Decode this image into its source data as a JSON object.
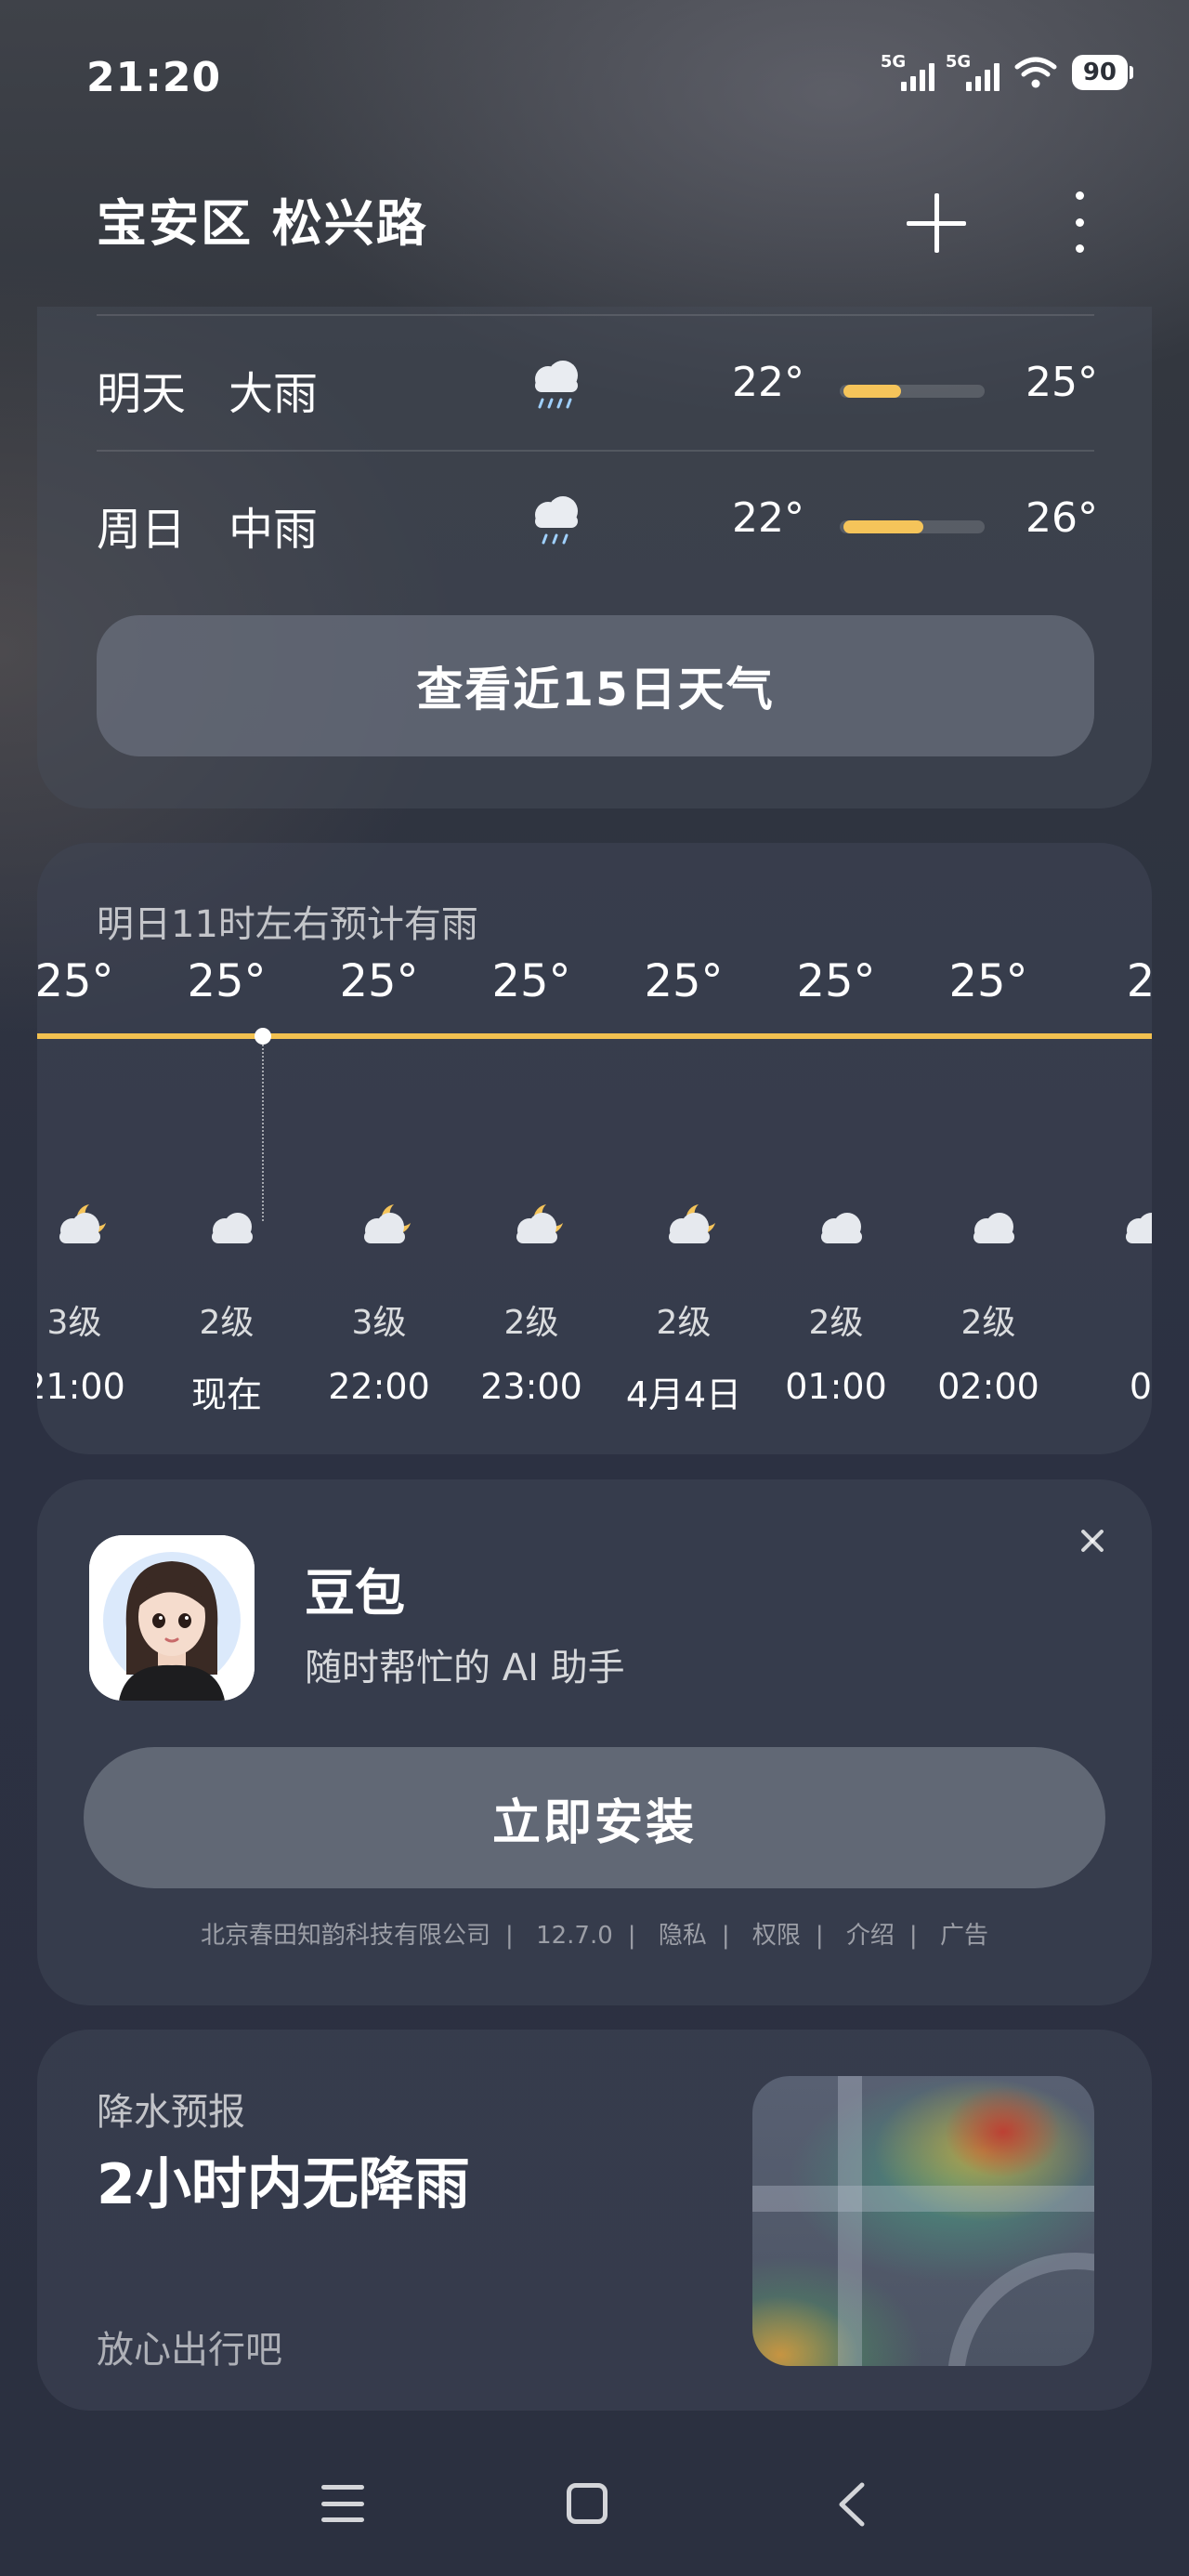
{
  "status_bar": {
    "time": "21:20",
    "sim1": "5G",
    "sim2": "5G",
    "battery": "90"
  },
  "header": {
    "location": "宝安区 松兴路",
    "add_icon": "plus-icon",
    "more_icon": "more-vertical-icon"
  },
  "daily": {
    "rows": [
      {
        "day": "明天",
        "condition": "大雨",
        "icon": "heavy-rain-icon",
        "low": "22°",
        "high": "25°",
        "range_fill": 0.4
      },
      {
        "day": "周日",
        "condition": "中雨",
        "icon": "moderate-rain-icon",
        "low": "22°",
        "high": "26°",
        "range_fill": 0.55
      }
    ],
    "button_label": "查看近15日天气"
  },
  "hourly": {
    "hint": "明日11时左右预计有雨",
    "items": [
      {
        "temp": "25°",
        "icon": "moon-cloud-icon",
        "wind": "3级",
        "time": "21:00"
      },
      {
        "temp": "25°",
        "icon": "cloud-icon",
        "wind": "2级",
        "time": "现在"
      },
      {
        "temp": "25°",
        "icon": "moon-cloud-icon",
        "wind": "3级",
        "time": "22:00"
      },
      {
        "temp": "25°",
        "icon": "moon-cloud-icon",
        "wind": "2级",
        "time": "23:00"
      },
      {
        "temp": "25°",
        "icon": "moon-cloud-icon",
        "wind": "2级",
        "time": "4月4日"
      },
      {
        "temp": "25°",
        "icon": "cloud-icon",
        "wind": "2级",
        "time": "01:00"
      },
      {
        "temp": "25°",
        "icon": "cloud-icon",
        "wind": "2级",
        "time": "02:00"
      },
      {
        "temp": "2",
        "icon": "cloud-icon",
        "wind": "",
        "time": "0"
      }
    ],
    "line_color": "#f2c150"
  },
  "ad": {
    "app_name": "豆包",
    "description": "随时帮忙的 AI 助手",
    "install_label": "立即安装",
    "footer": [
      "北京春田知韵科技有限公司",
      "12.7.0",
      "隐私",
      "权限",
      "介绍",
      "广告"
    ],
    "separator": "|"
  },
  "precip": {
    "title": "降水预报",
    "main": "2小时内无降雨",
    "sub": "放心出行吧"
  },
  "nav": {
    "menu_icon": "menu-icon",
    "home_icon": "home-square-icon",
    "back_icon": "back-chevron-icon"
  }
}
